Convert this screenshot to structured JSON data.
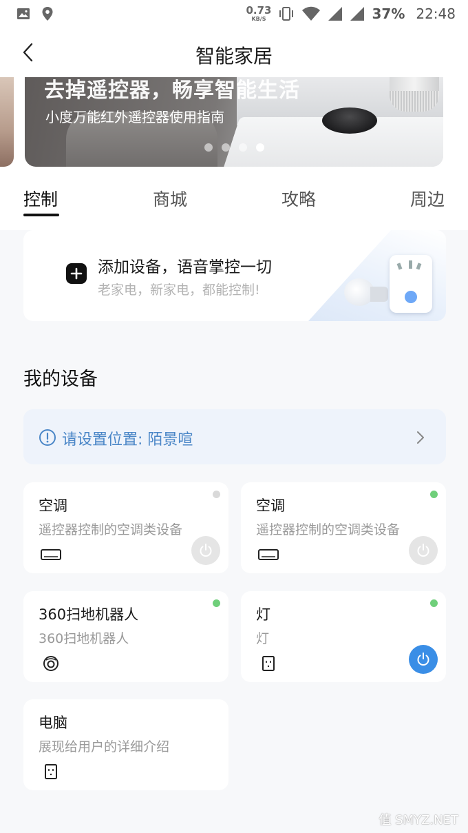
{
  "status_bar": {
    "net_speed": "0.73",
    "net_unit": "KB/S",
    "battery": "37%",
    "time": "22:48",
    "left_icons": [
      "image-icon",
      "location-pin-icon"
    ],
    "right_icons": [
      "vibrate-icon",
      "wifi-icon",
      "signal-icon",
      "signal-icon"
    ]
  },
  "header": {
    "title": "智能家居"
  },
  "banner": {
    "headline": "去掉遥控器，畅享智能生活",
    "subtitle": "小度万能红外遥控器使用指南",
    "slide_count": 4,
    "active_slide": 4
  },
  "tabs": [
    {
      "label": "控制",
      "active": true
    },
    {
      "label": "商城",
      "active": false
    },
    {
      "label": "攻略",
      "active": false
    },
    {
      "label": "周边",
      "active": false
    }
  ],
  "add_device": {
    "title": "添加设备，语音掌控一切",
    "subtitle": "老家电，新家电，都能控制!"
  },
  "my_devices": {
    "title": "我的设备",
    "location_prompt": "请设置位置: 陌景喧",
    "devices": [
      {
        "name": "空调",
        "desc": "遥控器控制的空调类设备",
        "icon": "air-conditioner-icon",
        "status": "offline",
        "power": "off"
      },
      {
        "name": "空调",
        "desc": "遥控器控制的空调类设备",
        "icon": "air-conditioner-icon",
        "status": "online",
        "power": "off"
      },
      {
        "name": "360扫地机器人",
        "desc": "360扫地机器人",
        "icon": "robot-vacuum-icon",
        "status": "online",
        "power": null
      },
      {
        "name": "灯",
        "desc": "灯",
        "icon": "socket-icon",
        "status": "online",
        "power": "on"
      },
      {
        "name": "电脑",
        "desc": "展现给用户的详细介绍",
        "icon": "socket-icon",
        "status": null,
        "power": null
      }
    ]
  },
  "watermark": "值 SMYZ.NET",
  "colors": {
    "accent_blue": "#3a8ee6",
    "online_green": "#6fcf7a",
    "location_text": "#4a86c7",
    "location_bg": "#eef3fb"
  }
}
